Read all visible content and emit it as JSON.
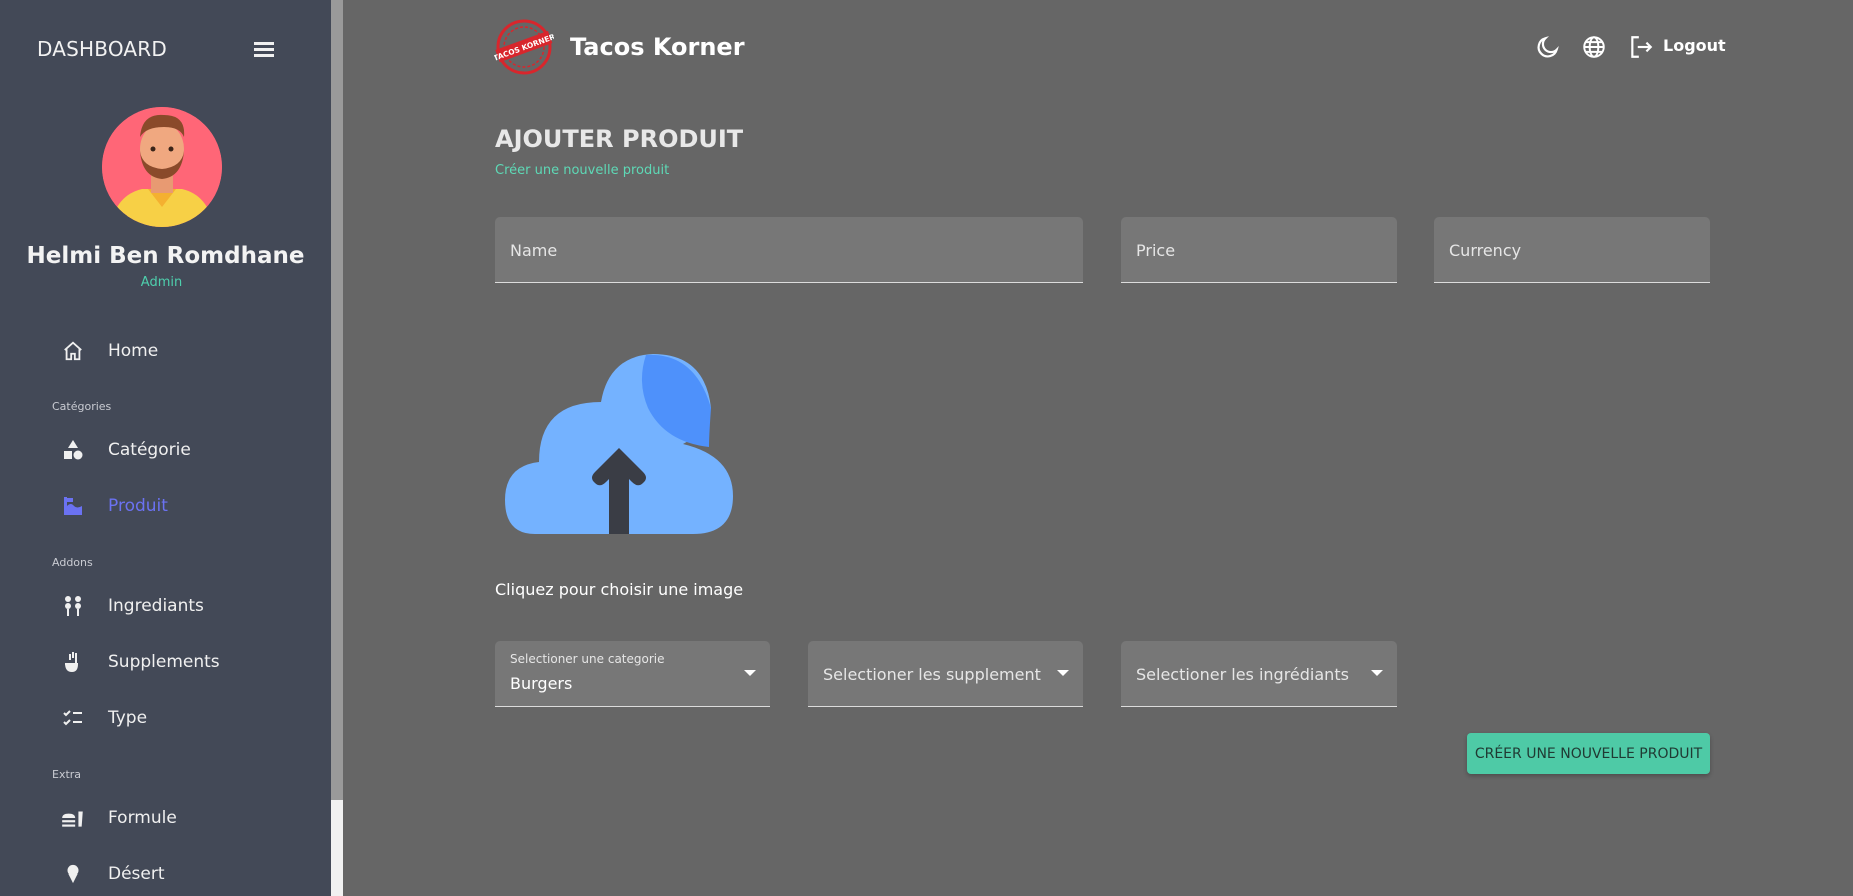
{
  "sidebar": {
    "title": "DASHBOARD",
    "profile": {
      "name": "Helmi Ben Romdhane",
      "role": "Admin"
    },
    "items": [
      {
        "label": "Home",
        "icon": "home-icon"
      },
      {
        "label": "Catégorie",
        "icon": "shapes-icon"
      },
      {
        "label": "Produit",
        "icon": "product-icon",
        "active": true
      },
      {
        "label": "Ingrediants",
        "icon": "ingredients-icon"
      },
      {
        "label": "Supplements",
        "icon": "supplements-icon"
      },
      {
        "label": "Type",
        "icon": "checklist-icon"
      },
      {
        "label": "Formule",
        "icon": "fastfood-icon"
      },
      {
        "label": "Désert",
        "icon": "icecream-icon"
      }
    ],
    "sections": [
      "Catégories",
      "Addons",
      "Extra"
    ]
  },
  "header": {
    "brand": "Tacos Korner",
    "logo_text": "TACOS KORNER",
    "logout_label": "Logout"
  },
  "main": {
    "title": "AJOUTER PRODUIT",
    "subtitle": "Créer une nouvelle produit",
    "fields": {
      "name_placeholder": "Name",
      "price_placeholder": "Price",
      "currency_placeholder": "Currency"
    },
    "upload_label": "Cliquez pour choisir une image",
    "selects": {
      "category_label": "Selectioner une categorie",
      "category_value": "Burgers",
      "supplements_placeholder": "Selectioner les supplement",
      "ingredients_placeholder": "Selectioner les ingrédiants"
    },
    "submit_label": "CRÉER UNE NOUVELLE PRODUIT"
  },
  "colors": {
    "sidebar_bg": "#434957",
    "content_bg": "#666666",
    "accent": "#4ecaa6",
    "active_nav": "#6b72f2",
    "upload_cloud": "#74b2ff"
  }
}
